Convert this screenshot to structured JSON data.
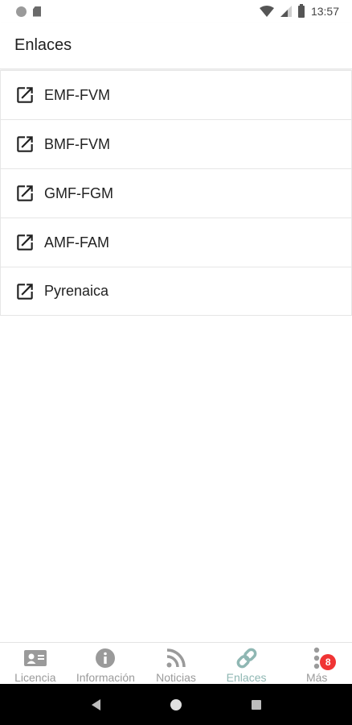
{
  "status_bar": {
    "time": "13:57",
    "icons": [
      "notification-dot-icon",
      "sim-card-icon",
      "wifi-icon",
      "signal-icon",
      "battery-icon"
    ]
  },
  "header": {
    "title": "Enlaces"
  },
  "links": [
    {
      "label": "EMF-FVM",
      "icon": "external-link-icon"
    },
    {
      "label": "BMF-FVM",
      "icon": "external-link-icon"
    },
    {
      "label": "GMF-FGM",
      "icon": "external-link-icon"
    },
    {
      "label": "AMF-FAM",
      "icon": "external-link-icon"
    },
    {
      "label": "Pyrenaica",
      "icon": "external-link-icon"
    }
  ],
  "bottom_nav": {
    "items": [
      {
        "label": "Licencia",
        "icon": "id-card-icon",
        "active": false
      },
      {
        "label": "Información",
        "icon": "info-icon",
        "active": false
      },
      {
        "label": "Noticias",
        "icon": "rss-icon",
        "active": false
      },
      {
        "label": "Enlaces",
        "icon": "link-icon",
        "active": true
      },
      {
        "label": "Más",
        "icon": "more-vertical-icon",
        "active": false,
        "badge": "8"
      }
    ]
  },
  "colors": {
    "active_nav": "#8fb7b3",
    "inactive_nav": "#9a9a9a",
    "badge": "#f03434"
  }
}
